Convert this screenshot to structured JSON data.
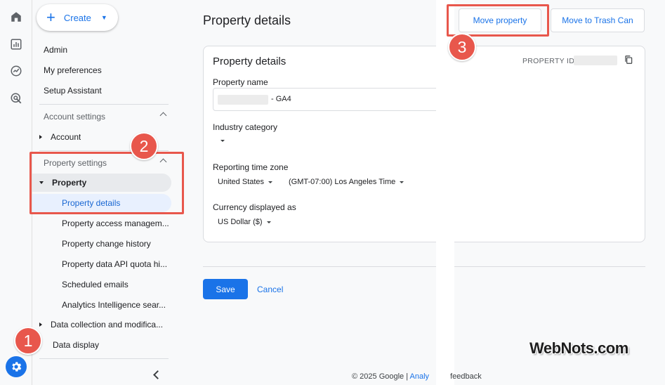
{
  "rail": {
    "icons": [
      "home-icon",
      "reports-icon",
      "explore-icon",
      "advertising-icon",
      "admin-gear-icon"
    ]
  },
  "nav": {
    "create_label": "Create",
    "admin": "Admin",
    "my_preferences": "My preferences",
    "setup_assistant": "Setup Assistant",
    "account_settings": "Account settings",
    "account": "Account",
    "property_settings": "Property settings",
    "property": "Property",
    "property_details": "Property details",
    "property_access": "Property access managem...",
    "property_change_history": "Property change history",
    "property_data_api": "Property data API quota hi...",
    "scheduled_emails": "Scheduled emails",
    "analytics_intelligence": "Analytics Intelligence sear...",
    "data_collection": "Data collection and modifica...",
    "data_display": "Data display"
  },
  "main": {
    "page_title": "Property details",
    "move_property": "Move property",
    "move_to_trash": "Move to Trash Can",
    "card_title": "Property details",
    "property_id_label": "PROPERTY ID:",
    "property_name_label": "Property name",
    "property_name_suffix": "- GA4",
    "industry_category_label": "Industry category",
    "reporting_tz_label": "Reporting time zone",
    "country": "United States",
    "timezone": "(GMT-07:00) Los Angeles Time",
    "currency_label": "Currency displayed as",
    "currency": "US Dollar ($)",
    "save": "Save",
    "cancel": "Cancel"
  },
  "annotations": {
    "step1": "1",
    "step2": "2",
    "step3": "3"
  },
  "footer": {
    "copyright": "© 2025 Google |",
    "link": "Analy",
    "feedback": "feedback"
  },
  "watermark": "WebNots.com",
  "colors": {
    "accent": "#1a73e8",
    "annotation": "#e8574c",
    "selected_bg": "#e8f0fe"
  }
}
